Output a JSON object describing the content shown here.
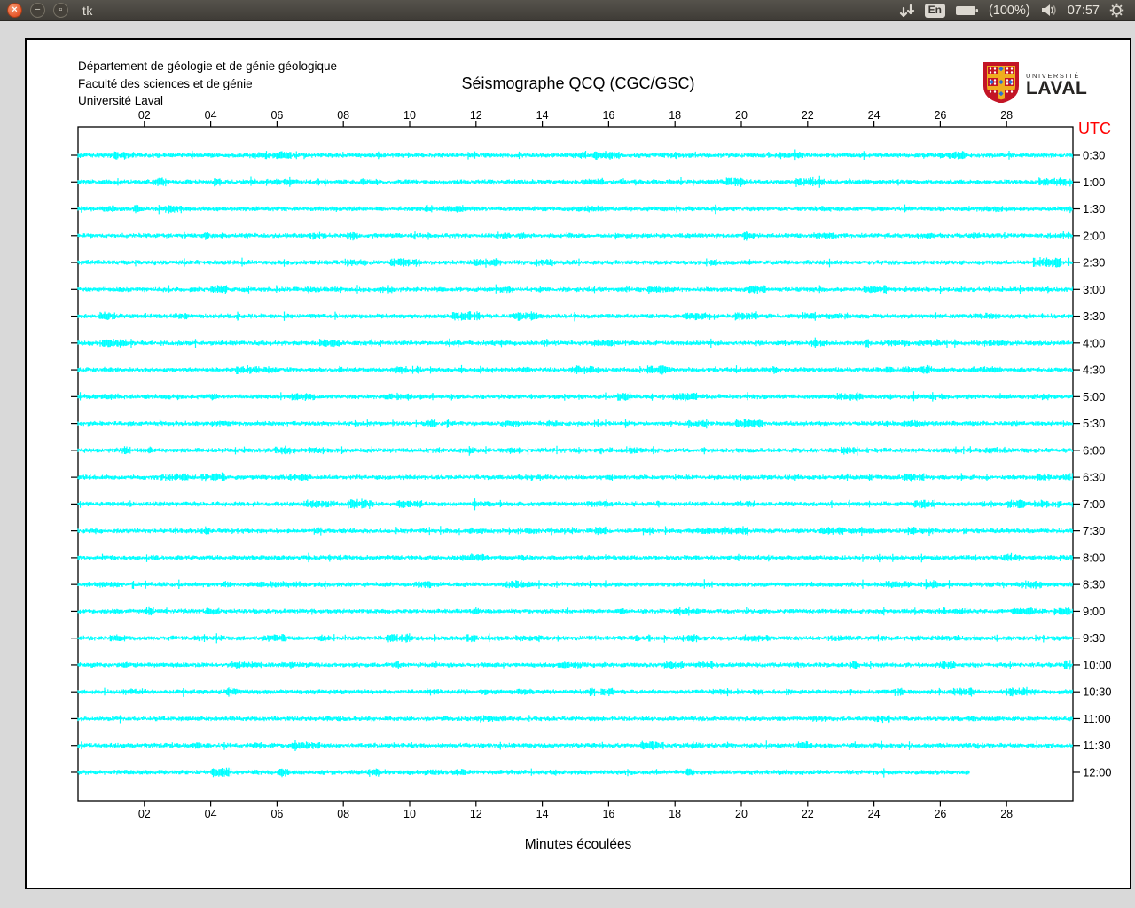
{
  "titlebar": {
    "title": "tk",
    "close_glyph": "×",
    "minimize_glyph": "−",
    "maximize_glyph": "▫",
    "keyboard_layout": "En",
    "battery_percent": "(100%)",
    "clock": "07:57"
  },
  "header": {
    "lines": [
      "Département de géologie et de génie géologique",
      "Faculté des sciences et de génie",
      "Université Laval"
    ],
    "title": "Séismographe QCQ (CGC/GSC)",
    "logo": {
      "line1": "UNIVERSITÉ",
      "line2": "LAVAL"
    }
  },
  "chart_data": {
    "type": "line",
    "subtype": "seismograph-helicorder",
    "title": "Séismographe QCQ (CGC/GSC)",
    "xlabel": "Minutes écoulées",
    "right_axis_label": "UTC",
    "x_range": [
      0,
      30
    ],
    "x_ticks": [
      "02",
      "04",
      "06",
      "08",
      "10",
      "12",
      "14",
      "16",
      "18",
      "20",
      "22",
      "24",
      "26",
      "28"
    ],
    "trace_color": "#00ffff",
    "utc_label_color": "#ff0000",
    "frame_color": "#000000",
    "rows": [
      {
        "utc": "0:30",
        "end_minute": 30
      },
      {
        "utc": "1:00",
        "end_minute": 30
      },
      {
        "utc": "1:30",
        "end_minute": 30
      },
      {
        "utc": "2:00",
        "end_minute": 30
      },
      {
        "utc": "2:30",
        "end_minute": 30
      },
      {
        "utc": "3:00",
        "end_minute": 30
      },
      {
        "utc": "3:30",
        "end_minute": 30
      },
      {
        "utc": "4:00",
        "end_minute": 30
      },
      {
        "utc": "4:30",
        "end_minute": 30
      },
      {
        "utc": "5:00",
        "end_minute": 30
      },
      {
        "utc": "5:30",
        "end_minute": 30
      },
      {
        "utc": "6:00",
        "end_minute": 30
      },
      {
        "utc": "6:30",
        "end_minute": 30
      },
      {
        "utc": "7:00",
        "end_minute": 30
      },
      {
        "utc": "7:30",
        "end_minute": 30
      },
      {
        "utc": "8:00",
        "end_minute": 30
      },
      {
        "utc": "8:30",
        "end_minute": 30
      },
      {
        "utc": "9:00",
        "end_minute": 30
      },
      {
        "utc": "9:30",
        "end_minute": 30
      },
      {
        "utc": "10:00",
        "end_minute": 30
      },
      {
        "utc": "10:30",
        "end_minute": 30
      },
      {
        "utc": "11:00",
        "end_minute": 30
      },
      {
        "utc": "11:30",
        "end_minute": 30
      },
      {
        "utc": "12:00",
        "end_minute": 26.9
      }
    ]
  }
}
